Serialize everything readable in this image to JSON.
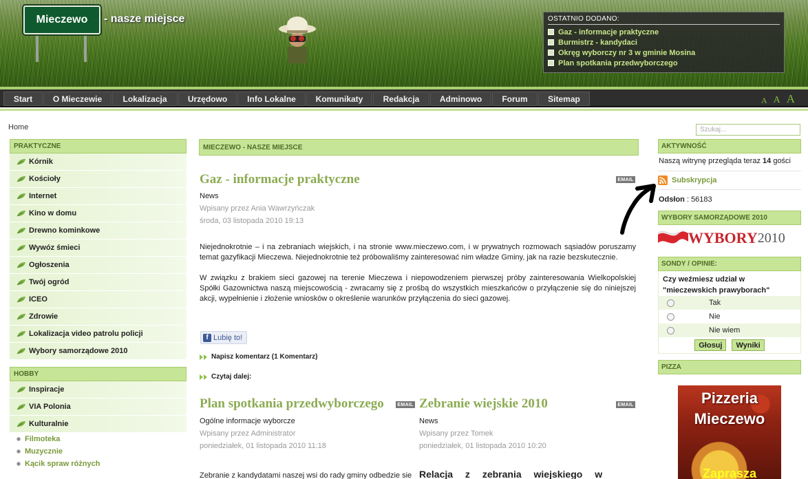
{
  "header": {
    "logo_text": "Mieczewo",
    "slogan": "- nasze miejsce",
    "recent": {
      "title": "OSTATNIO DODANO:",
      "items": [
        "Gaz - informacje praktyczne",
        "Burmistrz - kandydaci",
        "Okręg wyborczy nr 3 w gminie Mosina",
        "Plan spotkania przedwyborczego"
      ]
    }
  },
  "nav": {
    "items": [
      "Start",
      "O Mieczewie",
      "Lokalizacja",
      "Urzędowo",
      "Info Lokalne",
      "Komunikaty",
      "Redakcja",
      "Adminowo",
      "Forum",
      "Sitemap"
    ],
    "font_sizes": [
      "A",
      "A",
      "A"
    ]
  },
  "breadcrumb": "Home",
  "search": {
    "placeholder": "Szukaj..."
  },
  "left": {
    "praktyczne_title": "PRAKTYCZNE",
    "praktyczne": [
      "Kórnik",
      "Kościoły",
      "Internet",
      "Kino w domu",
      "Drewno kominkowe",
      "Wywóz śmieci",
      "Ogłoszenia",
      "Twój ogród",
      "ICEO",
      "Zdrowie",
      "Lokalizacja video patrolu policji",
      "Wybory samorządowe 2010"
    ],
    "hobby_title": "HOBBY",
    "hobby": [
      "Inspiracje",
      "VIA Polonia",
      "Kulturalnie"
    ],
    "sub": [
      "Filmoteka",
      "Muzycznie",
      "Kącik spraw różnych"
    ]
  },
  "center": {
    "title": "MIECZEWO - NASZE MIEJSCE",
    "main": {
      "title": "Gaz - informacje praktyczne",
      "category": "News",
      "author": "Wpisany przez Ania Wawrzyńczak",
      "date": "środa, 03 listopada 2010 19:13",
      "p1": "Niejednokrotnie – i na zebraniach wiejskich, i na stronie www.mieczewo.com, i w prywatnych rozmowach sąsiadów poruszamy temat gazyfikacji Mieczewa. Niejednokrotnie też próbowaliśmy zainteresować nim władze Gminy, jak na razie bezskutecznie.",
      "p2": "W związku z brakiem sieci gazowej na terenie Mieczewa i niepowodzeniem pierwszej próby zainteresowania Wielkopolskiej Spółki Gazownictwa naszą miejscowością - zwracamy się z prośbą do wszystkich mieszkańców o przyłączenie się do niniejszej akcji, wypełnienie i złożenie wniosków o określenie warunków przyłączenia do sieci gazowej.",
      "like": "Lubię to!",
      "comment": "Napisz komentarz (1 Komentarz)",
      "readmore": "Czytaj dalej:"
    },
    "email_label": "EMAIL",
    "col1": {
      "title": "Plan spotkania przedwyborczego",
      "category": "Ogólne informacje wyborcze",
      "author": "Wpisany przez Administrator",
      "date": "poniedziałek, 01 listopada 2010 11:18",
      "text": "Zebranie z kandydatami naszej wsi do rady gminy odbedzie sie"
    },
    "col2": {
      "title": "Zebranie wiejskie 2010",
      "category": "News",
      "author": "Wpisany przez Tomek",
      "date": "poniedziałek, 01 listopada 2010 10:20",
      "text": "Relacja z zebrania wiejskiego w"
    }
  },
  "right": {
    "activity_title": "AKTYWNOŚĆ",
    "online_prefix": "Naszą witrynę przegląda teraz ",
    "online_count": "14",
    "online_suffix": " gości",
    "rss": "Subskrypcja",
    "views_label": "Odsłon",
    "views_value": "56183",
    "wybory_title": "WYBORY SAMORZĄDOWE 2010",
    "wybory_banner": "WYBORY",
    "wybory_year": "2010",
    "poll_title": "SONDY / OPINIE:",
    "poll_question": "Czy weźmiesz udział w \"mieczewskich prawyborach\"",
    "poll_options": [
      "Tak",
      "Nie",
      "Nie wiem"
    ],
    "vote": "Głosuj",
    "results": "Wyniki",
    "pizza_title": "PIZZA",
    "pizza_line1": "Pizzeria",
    "pizza_line2": "Mieczewo",
    "pizza_line3": "Zaprasza"
  }
}
